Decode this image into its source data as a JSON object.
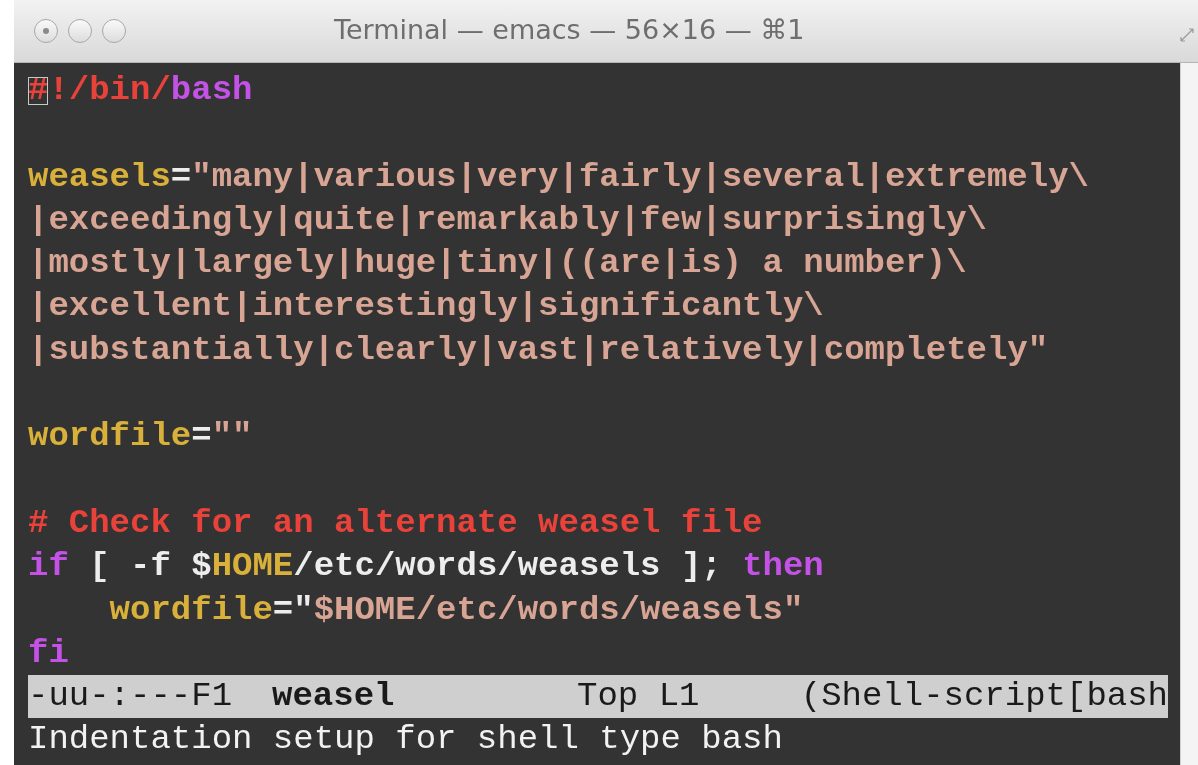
{
  "window": {
    "title": "Terminal — emacs — 56×16 — ⌘1"
  },
  "lines": [
    {
      "cursor_at_start": true,
      "indented": false,
      "segments": [
        {
          "kind": "comment",
          "text": "#!/bin/"
        },
        {
          "kind": "keyword",
          "text": "bash"
        }
      ]
    },
    {
      "cursor_at_start": false
    },
    {
      "cursor_at_start": false,
      "indented": false,
      "segments": [
        {
          "kind": "variable",
          "text": "weasels"
        },
        {
          "kind": "plain",
          "text": "="
        },
        {
          "kind": "string",
          "text": "\"many|various|very|fairly|several|extremely\\"
        }
      ]
    },
    {
      "cursor_at_start": false,
      "indented": false,
      "segments": [
        {
          "kind": "string",
          "text": "|exceedingly|quite|remarkably|few|surprisingly\\"
        }
      ]
    },
    {
      "cursor_at_start": false,
      "indented": false,
      "segments": [
        {
          "kind": "string",
          "text": "|mostly|largely|huge|tiny|((are|is) a number)\\"
        }
      ]
    },
    {
      "cursor_at_start": false,
      "indented": false,
      "segments": [
        {
          "kind": "string",
          "text": "|excellent|interestingly|significantly\\"
        }
      ]
    },
    {
      "cursor_at_start": false,
      "indented": false,
      "segments": [
        {
          "kind": "string",
          "text": "|substantially|clearly|vast|relatively|completely\""
        }
      ]
    },
    {
      "cursor_at_start": false
    },
    {
      "cursor_at_start": false,
      "indented": false,
      "segments": [
        {
          "kind": "variable",
          "text": "wordfile"
        },
        {
          "kind": "plain",
          "text": "="
        },
        {
          "kind": "string",
          "text": "\"\""
        }
      ]
    },
    {
      "cursor_at_start": false
    },
    {
      "cursor_at_start": false,
      "indented": false,
      "segments": [
        {
          "kind": "comment",
          "text": "# Check for an alternate weasel file"
        }
      ]
    },
    {
      "cursor_at_start": false,
      "indented": false,
      "segments": [
        {
          "kind": "keyword",
          "text": "if"
        },
        {
          "kind": "plain",
          "text": " [ -f $"
        },
        {
          "kind": "variable",
          "text": "HOME"
        },
        {
          "kind": "plain",
          "text": "/etc/words/weasels ]; "
        },
        {
          "kind": "keyword",
          "text": "then"
        }
      ]
    },
    {
      "cursor_at_start": false,
      "indented": true,
      "segments": [
        {
          "kind": "variable",
          "text": "wordfile"
        },
        {
          "kind": "plain",
          "text": "=\""
        },
        {
          "kind": "string",
          "text": "$HOME/etc/words/weasels\""
        }
      ]
    },
    {
      "cursor_at_start": false,
      "indented": false,
      "segments": [
        {
          "kind": "keyword",
          "text": "fi"
        }
      ]
    }
  ],
  "mode_line": {
    "status": "-uu-:---F1",
    "buffer_name": "weasel",
    "position": "Top L1",
    "mode": "(Shell-script[bash"
  },
  "echo_area": "Indentation setup for shell type bash"
}
